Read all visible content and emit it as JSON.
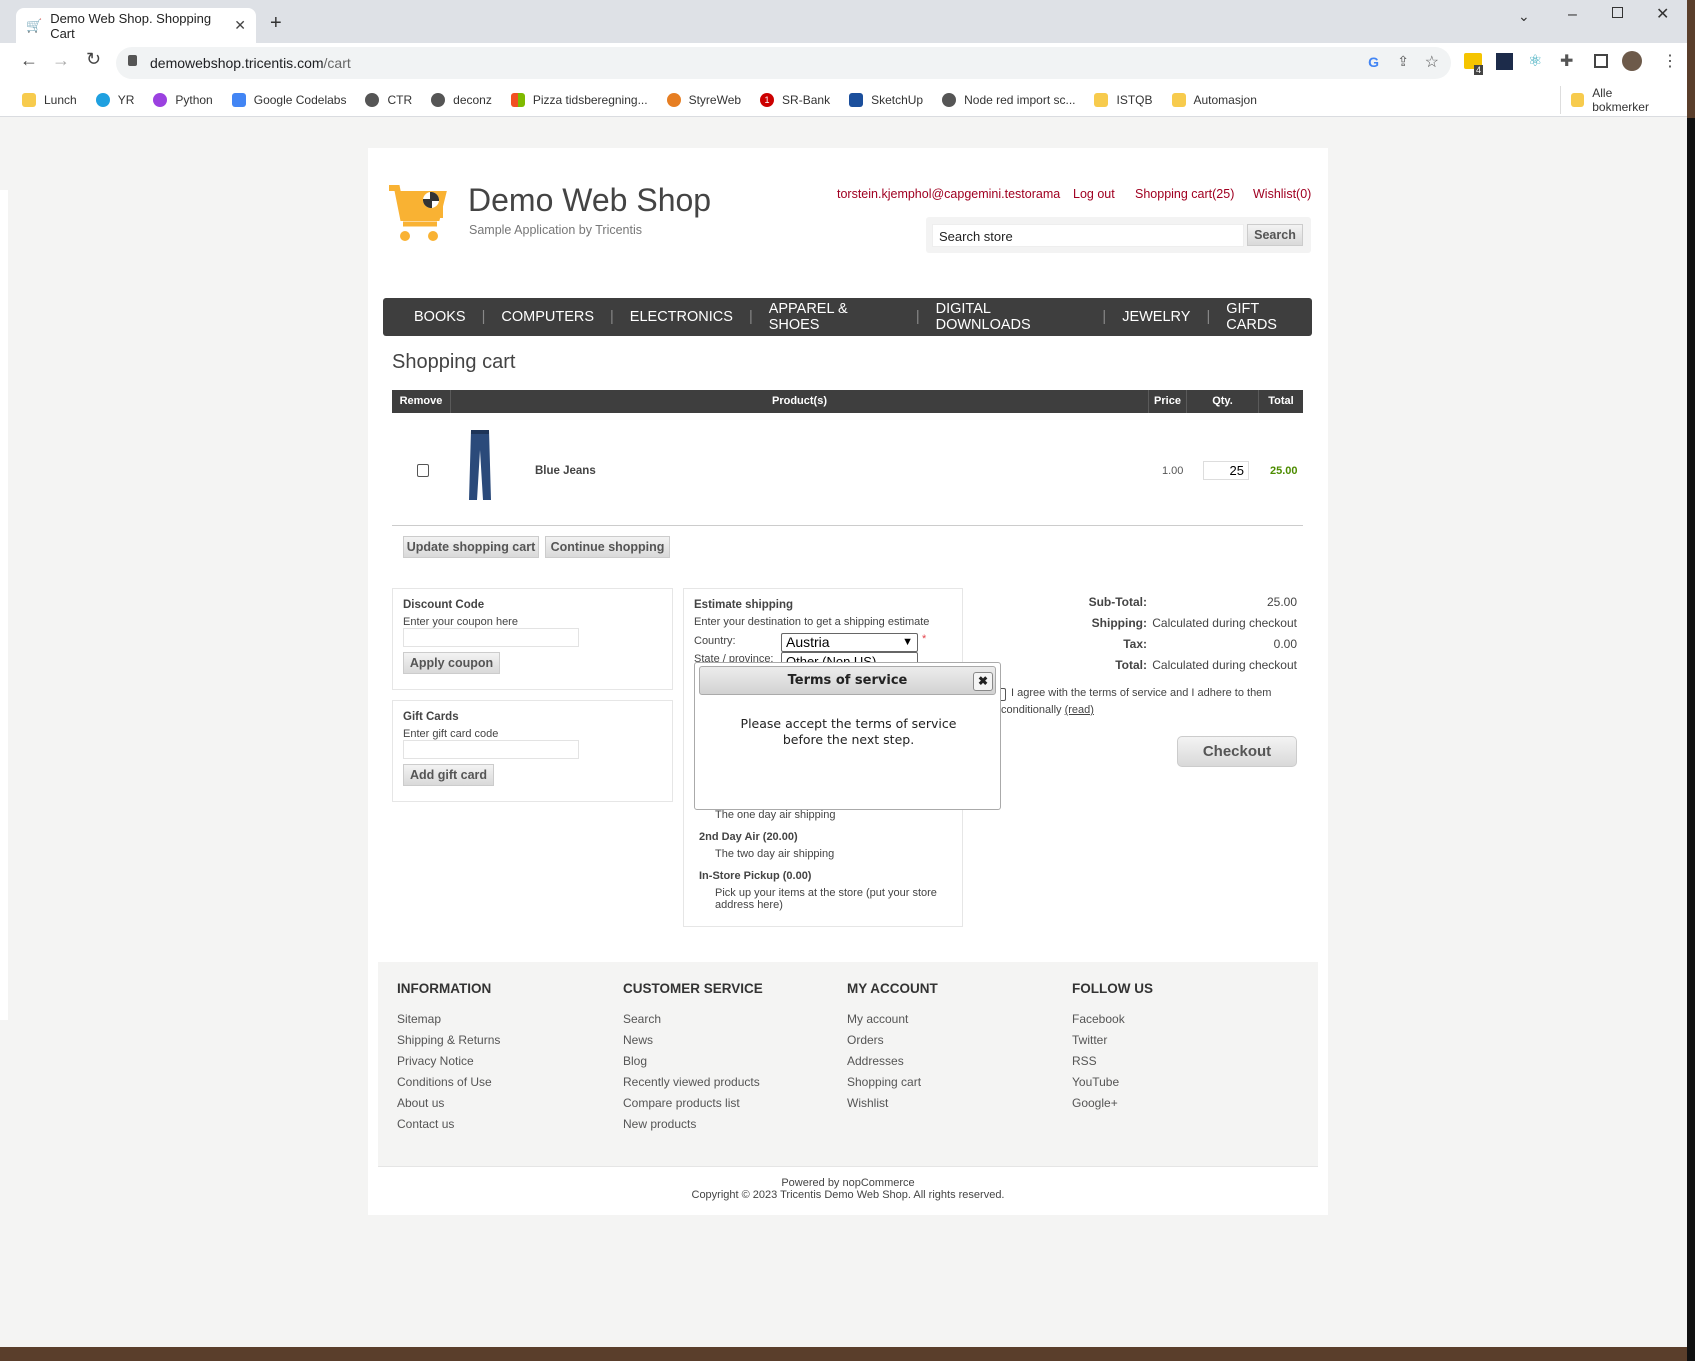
{
  "browser": {
    "tab_title": "Demo Web Shop. Shopping Cart",
    "url_host": "demowebshop.tricentis.com",
    "url_path": "/cart",
    "bookmarks": [
      {
        "label": "Lunch",
        "color": "#f7cb4d"
      },
      {
        "label": "YR",
        "color": "#1fa0e0"
      },
      {
        "label": "Python",
        "color": "#9b41e0"
      },
      {
        "label": "Google Codelabs",
        "color": "#4285f4"
      },
      {
        "label": "CTR",
        "color": "#555555"
      },
      {
        "label": "deconz",
        "color": "#555555"
      },
      {
        "label": "Pizza tidsberegning...",
        "color": "#f25022"
      },
      {
        "label": "StyreWeb",
        "color": "#e67e22"
      },
      {
        "label": "SR-Bank",
        "color": "#cc0000"
      },
      {
        "label": "SketchUp",
        "color": "#1b4f9c"
      },
      {
        "label": "Node red import sc...",
        "color": "#555555"
      },
      {
        "label": "ISTQB",
        "color": "#f7cb4d"
      },
      {
        "label": "Automasjon",
        "color": "#f7cb4d"
      }
    ],
    "all_bookmarks": "Alle bokmerker",
    "extension_badge": "4"
  },
  "header": {
    "logo_title": "Demo Web Shop",
    "logo_subtitle": "Sample Application by Tricentis",
    "account": "torstein.kjemphol@capgemini.testorama",
    "logout": "Log out",
    "cart": "Shopping cart(25)",
    "wishlist": "Wishlist(0)",
    "search_placeholder": "Search store",
    "search_button": "Search"
  },
  "nav": [
    "BOOKS",
    "COMPUTERS",
    "ELECTRONICS",
    "APPAREL & SHOES",
    "DIGITAL DOWNLOADS",
    "JEWELRY",
    "GIFT CARDS"
  ],
  "cart": {
    "title": "Shopping cart",
    "columns": [
      "Remove",
      "Product(s)",
      "Price",
      "Qty.",
      "Total"
    ],
    "items": [
      {
        "name": "Blue Jeans",
        "price": "1.00",
        "qty": "25",
        "total": "25.00"
      }
    ],
    "update_button": "Update shopping cart",
    "continue_button": "Continue shopping"
  },
  "discount": {
    "title": "Discount Code",
    "hint": "Enter your coupon here",
    "button": "Apply coupon"
  },
  "giftcard": {
    "title": "Gift Cards",
    "hint": "Enter gift card code",
    "button": "Add gift card"
  },
  "shipping": {
    "title": "Estimate shipping",
    "hint": "Enter your destination to get a shipping estimate",
    "country_label": "Country:",
    "country_value": "Austria",
    "state_label": "State / province:",
    "state_value": "Other (Non US)",
    "required": "*",
    "options": [
      {
        "desc": "The one day air shipping"
      },
      {
        "name": "2nd Day Air (20.00)",
        "desc": "The two day air shipping"
      },
      {
        "name": "In-Store Pickup (0.00)",
        "desc": "Pick up your items at the store (put your store address here)"
      }
    ]
  },
  "totals": {
    "subtotal_label": "Sub-Total:",
    "subtotal": "25.00",
    "shipping_label": "Shipping:",
    "shipping": "Calculated during checkout",
    "tax_label": "Tax:",
    "tax": "0.00",
    "total_label": "Total:",
    "total": "Calculated during checkout",
    "terms_text": "I agree with the terms of service and I adhere to them",
    "terms_text2": "conditionally",
    "terms_read": "(read)",
    "checkout": "Checkout"
  },
  "modal": {
    "title": "Terms of service",
    "message_line1": "Please accept the terms of service",
    "message_line2": "before the next step."
  },
  "footer": {
    "columns": [
      {
        "title": "INFORMATION",
        "links": [
          "Sitemap",
          "Shipping & Returns",
          "Privacy Notice",
          "Conditions of Use",
          "About us",
          "Contact us"
        ]
      },
      {
        "title": "CUSTOMER SERVICE",
        "links": [
          "Search",
          "News",
          "Blog",
          "Recently viewed products",
          "Compare products list",
          "New products"
        ]
      },
      {
        "title": "MY ACCOUNT",
        "links": [
          "My account",
          "Orders",
          "Addresses",
          "Shopping cart",
          "Wishlist"
        ]
      },
      {
        "title": "FOLLOW US",
        "links": [
          "Facebook",
          "Twitter",
          "RSS",
          "YouTube",
          "Google+"
        ]
      }
    ],
    "powered": "Powered by nopCommerce",
    "copyright": "Copyright © 2023 Tricentis Demo Web Shop. All rights reserved."
  },
  "colors": {
    "link_red": "#a00021",
    "nav_bg": "#3e3e3e",
    "total_green": "#4d8c00",
    "logo_orange": "#f9b233"
  }
}
